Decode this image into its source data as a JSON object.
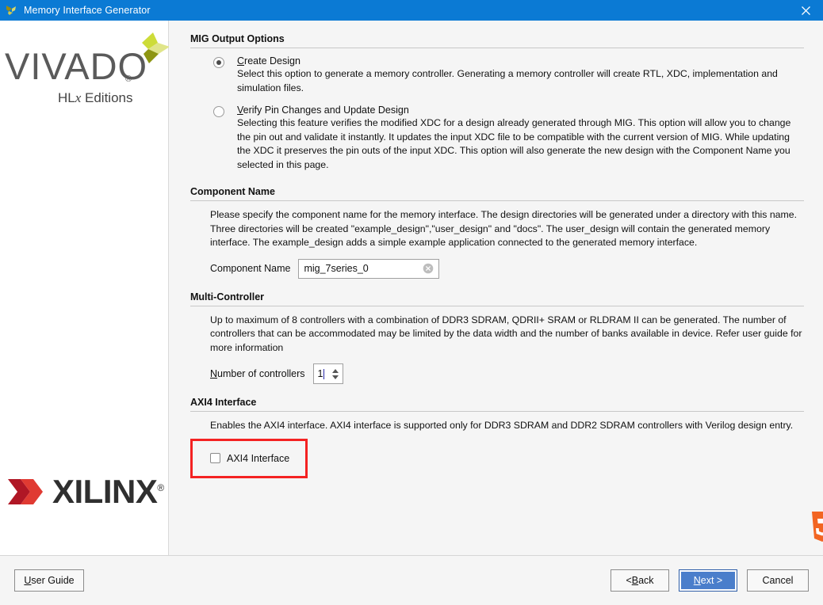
{
  "window": {
    "title": "Memory Interface Generator",
    "icon": "vivado-app-icon",
    "close_label": "close-icon"
  },
  "brand": {
    "vivado_word": "VIVADO",
    "vivado_reg": "®",
    "vivado_sub_pre": "HL",
    "vivado_sub_italic": "x",
    "vivado_sub_post": " Editions",
    "xilinx_word": "XILINX",
    "xilinx_reg": "®"
  },
  "sections": {
    "mig_output": {
      "header": "MIG Output Options",
      "options": [
        {
          "mnemonic": "C",
          "label_rest": "reate Design",
          "selected": true,
          "description": "Select this option to generate a memory controller. Generating a memory controller will create RTL, XDC, implementation and simulation files."
        },
        {
          "mnemonic": "V",
          "label_rest": "erify Pin Changes and Update Design",
          "selected": false,
          "description": "Selecting this feature verifies the modified XDC for a design already generated through MIG. This option will allow you to change the pin out and validate it instantly. It updates the input XDC file to be compatible with the current version of MIG. While updating the XDC it preserves the pin outs of the input XDC. This option will also generate the new design with the Component Name you selected in this page."
        }
      ]
    },
    "component_name": {
      "header": "Component Name",
      "description": "Please specify the component name for the memory interface. The design directories will be generated under a directory with this name. Three directories will be created \"example_design\",\"user_design\" and \"docs\". The user_design will contain the generated memory interface. The example_design adds a simple example application connected to the generated memory interface.",
      "field_label": "Component Name",
      "field_value": "mig_7series_0",
      "clear_icon": "clear-icon"
    },
    "multi_controller": {
      "header": "Multi-Controller",
      "description": "Up to maximum of 8 controllers with a combination of DDR3 SDRAM, QDRII+ SRAM or RLDRAM II can be generated. The number of controllers that can be accommodated may be limited by the data width and the number of banks available in device. Refer user guide for more information",
      "field_mnemonic": "N",
      "field_label_rest": "umber of controllers",
      "field_value": "1"
    },
    "axi4": {
      "header": "AXI4 Interface",
      "description": "Enables the AXI4 interface. AXI4 interface is supported only for DDR3 SDRAM and DDR2 SDRAM controllers with Verilog design entry.",
      "checkbox_label": "AXI4 Interface",
      "checked": false,
      "highlight_color": "#f42222"
    }
  },
  "footer": {
    "user_guide": {
      "mnemonic": "U",
      "rest": "ser Guide"
    },
    "back": {
      "pre": "< ",
      "mnemonic": "B",
      "rest": "ack"
    },
    "next": {
      "mnemonic": "N",
      "rest": "ext >"
    },
    "cancel": {
      "label": "Cancel"
    }
  },
  "colors": {
    "titlebar": "#0b7ad4",
    "next_button": "#4a7ecb",
    "highlight": "#f42222",
    "panel_bg": "#f5f5f5"
  }
}
